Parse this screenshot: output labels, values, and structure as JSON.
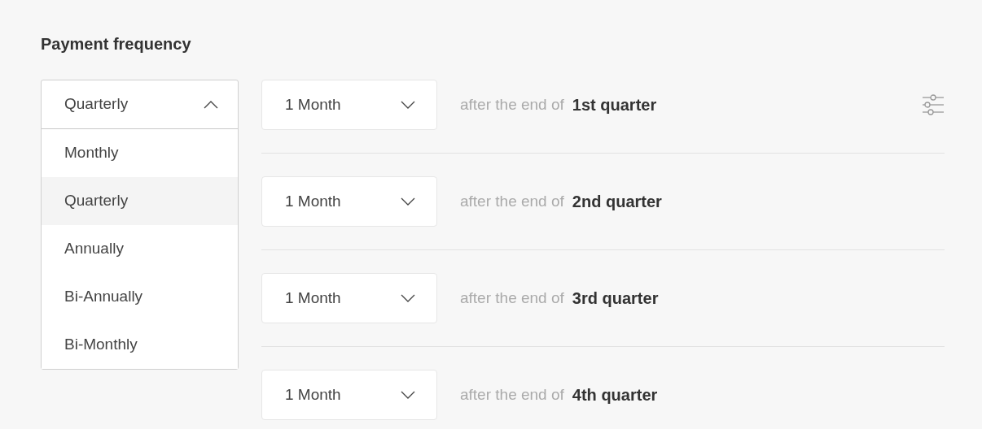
{
  "section_title": "Payment frequency",
  "frequency_dropdown": {
    "value": "Quarterly",
    "expanded": true,
    "options": [
      {
        "label": "Monthly",
        "selected": false
      },
      {
        "label": "Quarterly",
        "selected": true
      },
      {
        "label": "Annually",
        "selected": false
      },
      {
        "label": "Bi-Annually",
        "selected": false
      },
      {
        "label": "Bi-Monthly",
        "selected": false
      }
    ]
  },
  "rows": [
    {
      "delay": "1 Month",
      "prefix": "after the end of",
      "period": "1st quarter",
      "settings": true
    },
    {
      "delay": "1 Month",
      "prefix": "after the end of",
      "period": "2nd quarter",
      "settings": false
    },
    {
      "delay": "1 Month",
      "prefix": "after the end of",
      "period": "3rd quarter",
      "settings": false
    },
    {
      "delay": "1 Month",
      "prefix": "after the end of",
      "period": "4th quarter",
      "settings": false
    }
  ]
}
